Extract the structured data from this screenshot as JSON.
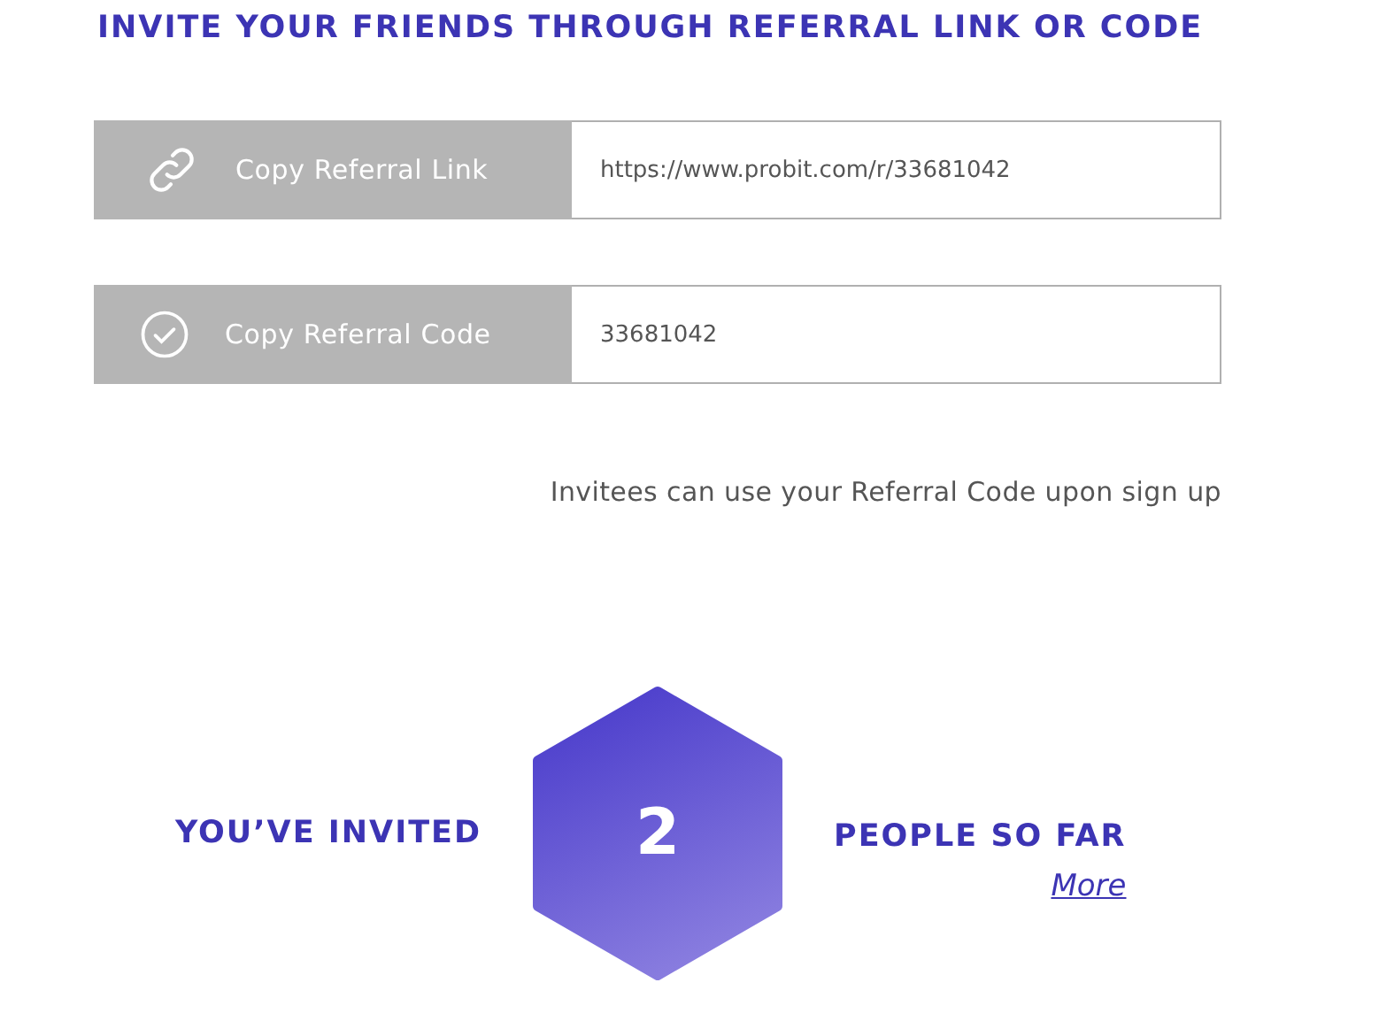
{
  "heading": "INVITE YOUR FRIENDS THROUGH REFERRAL LINK OR CODE",
  "referral_rows": [
    {
      "kind": "link",
      "button": "Copy Referral Link",
      "value": "https://www.probit.com/r/33681042"
    },
    {
      "kind": "code",
      "button": "Copy Referral Code",
      "value": "33681042"
    }
  ],
  "note": "Invitees can use your Referral Code upon sign up",
  "invited": {
    "prefix": "YOU’VE INVITED",
    "count": "2",
    "suffix": "PEOPLE SO FAR",
    "link": "More"
  }
}
